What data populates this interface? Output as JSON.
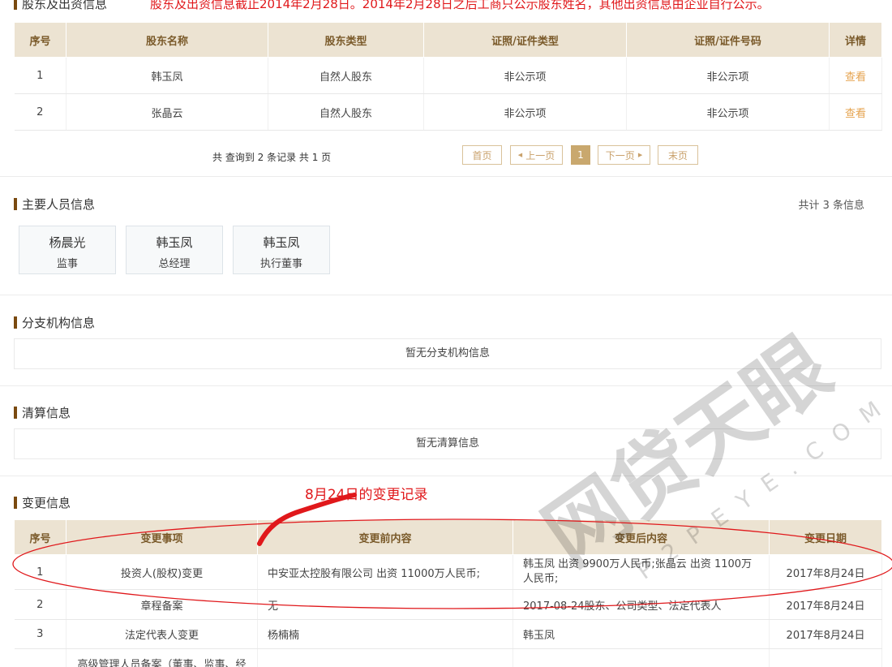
{
  "shareholders": {
    "title": "股东及出资信息",
    "note": "股东及出资信息截止2014年2月28日。2014年2月28日之后工商只公示股东姓名，其他出资信息由企业自行公示。",
    "headers": [
      "序号",
      "股东名称",
      "股东类型",
      "证照/证件类型",
      "证照/证件号码",
      "详情"
    ],
    "rows": [
      {
        "no": "1",
        "name": "韩玉凤",
        "type": "自然人股东",
        "cert_type": "非公示项",
        "cert_no": "非公示项",
        "detail": "查看"
      },
      {
        "no": "2",
        "name": "张晶云",
        "type": "自然人股东",
        "cert_type": "非公示项",
        "cert_no": "非公示项",
        "detail": "查看"
      }
    ],
    "summary": "共 查询到 2 条记录 共 1 页",
    "pager": {
      "first": "首页",
      "prev": "上一页",
      "current": "1",
      "next": "下一页",
      "last": "末页"
    }
  },
  "personnel": {
    "title": "主要人员信息",
    "count": "共计 3 条信息",
    "people": [
      {
        "name": "杨晨光",
        "role": "监事"
      },
      {
        "name": "韩玉凤",
        "role": "总经理"
      },
      {
        "name": "韩玉凤",
        "role": "执行董事"
      }
    ]
  },
  "branches": {
    "title": "分支机构信息",
    "empty": "暂无分支机构信息"
  },
  "liquidation": {
    "title": "清算信息",
    "empty": "暂无清算信息"
  },
  "changes": {
    "title": "变更信息",
    "annotation": "8月24日的变更记录",
    "headers": [
      "序号",
      "变更事项",
      "变更前内容",
      "变更后内容",
      "变更日期"
    ],
    "rows": [
      {
        "no": "1",
        "item": "投资人(股权)变更",
        "before": "中安亚太控股有限公司 出资 11000万人民币;",
        "after": "韩玉凤 出资 9900万人民币;张晶云 出资 1100万人民币;",
        "date": "2017年8月24日"
      },
      {
        "no": "2",
        "item": "章程备案",
        "before": "无",
        "after": "2017-08-24股东、公司类型、法定代表人",
        "date": "2017年8月24日"
      },
      {
        "no": "3",
        "item": "法定代表人变更",
        "before": "杨楠楠",
        "after": "韩玉凤",
        "date": "2017年8月24日"
      },
      {
        "no": "",
        "item": "高级管理人员备案（董事、监事、经",
        "before": "",
        "after": "",
        "date": ""
      }
    ]
  },
  "watermark": {
    "main": "网贷天眼",
    "sub": "P2PEYE.COM"
  },
  "colors": {
    "accent": "#7a4a10",
    "header_bg": "#ece3d2",
    "link": "#e5a34f",
    "annotation": "#e0181b"
  }
}
